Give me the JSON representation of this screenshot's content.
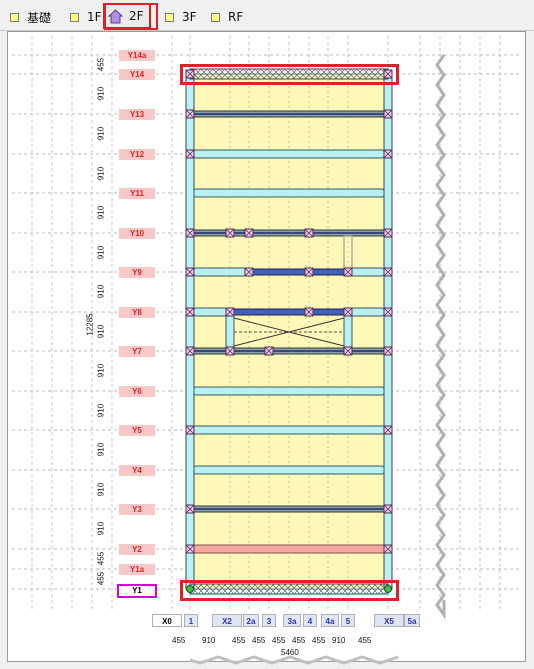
{
  "tabs": [
    {
      "label": "基礎",
      "active": false
    },
    {
      "label": "1F",
      "active": false
    },
    {
      "label": "2F",
      "active": true
    },
    {
      "label": "3F",
      "active": false
    },
    {
      "label": "RF",
      "active": false
    }
  ],
  "y_axis_labels": [
    "Y14a",
    "Y14",
    "Y13",
    "Y12",
    "Y11",
    "Y10",
    "Y9",
    "Y8",
    "Y7",
    "Y6",
    "Y5",
    "Y4",
    "Y3",
    "Y2",
    "Y1a",
    "Y1"
  ],
  "y_dims": [
    "455",
    "910",
    "910",
    "910",
    "910",
    "910",
    "910",
    "910",
    "910",
    "910",
    "910",
    "910",
    "910",
    "455",
    "455"
  ],
  "total_height_dim": "12285",
  "x_axis_labels": [
    "X0",
    "1",
    "X2",
    "2a",
    "3",
    "3a",
    "4",
    "4a",
    "5",
    "X5",
    "5a"
  ],
  "x_dims": [
    "455",
    "910",
    "455",
    "455",
    "455",
    "455",
    "455",
    "910",
    "455"
  ],
  "total_width_dim": "5460",
  "selected_y": "Y1",
  "colors": {
    "accent": "#e0202a",
    "label_pink": "#f8c8c8",
    "label_red": "#e02020",
    "beam_cyan": "#b8f0f4",
    "floor_yellow": "#fff8b8"
  }
}
